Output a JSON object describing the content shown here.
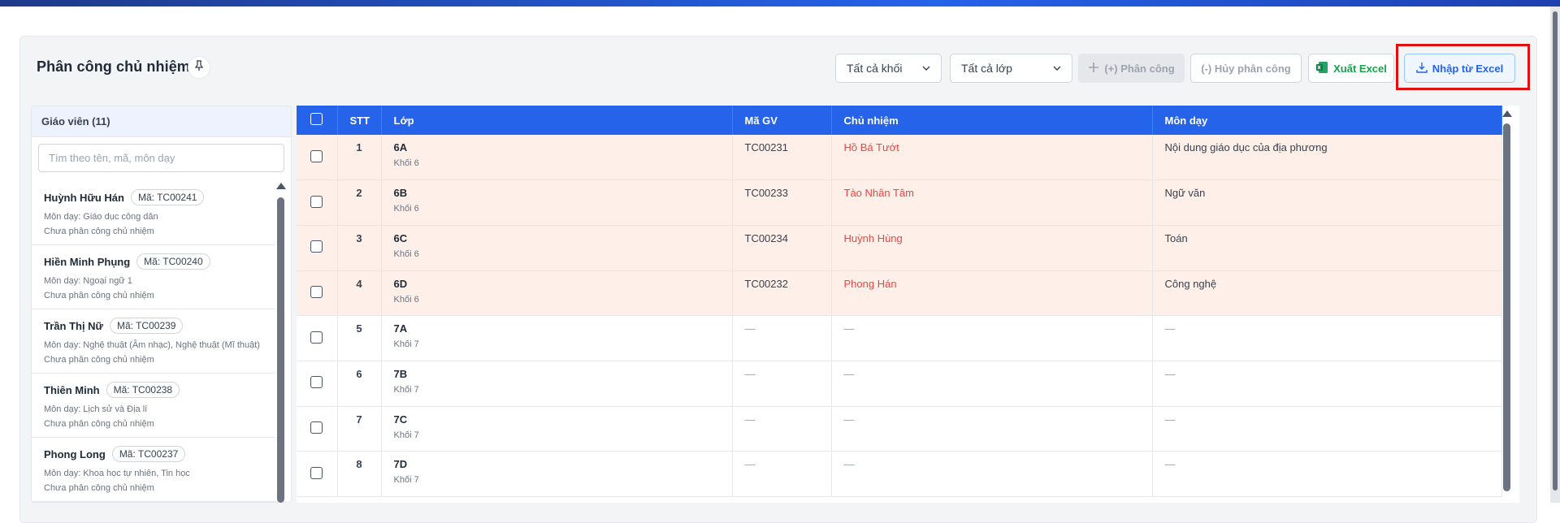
{
  "header": {
    "title": "Phân công chủ nhiệm",
    "grade_select": "Tất cả khối",
    "class_select": "Tất cả lớp",
    "assign_button": "(+) Phân công",
    "unassign_button": "(-) Hủy phân công",
    "export_button": "Xuất Excel",
    "import_button": "Nhập từ Excel"
  },
  "teachers_panel": {
    "title": "Giáo viên (11)",
    "search_placeholder": "Tìm theo tên, mã, môn dạy",
    "teachers": [
      {
        "name": "Huỳnh Hữu Hán",
        "code": "Mã: TC00241",
        "subject": "Môn dạy: Giáo dục công dân",
        "status": "Chưa phân công chủ nhiệm"
      },
      {
        "name": "Hiền Minh Phụng",
        "code": "Mã: TC00240",
        "subject": "Môn dạy: Ngoại ngữ 1",
        "status": "Chưa phân công chủ nhiệm"
      },
      {
        "name": "Trần Thị Nữ",
        "code": "Mã: TC00239",
        "subject": "Môn dạy: Nghệ thuật (Âm nhạc), Nghệ thuật (Mĩ thuật)",
        "status": "Chưa phân công chủ nhiệm"
      },
      {
        "name": "Thiên Minh",
        "code": "Mã: TC00238",
        "subject": "Môn dạy: Lịch sử và Địa lí",
        "status": "Chưa phân công chủ nhiệm"
      },
      {
        "name": "Phong Long",
        "code": "Mã: TC00237",
        "subject": "Môn dạy: Khoa học tự nhiên, Tin học",
        "status": "Chưa phân công chủ nhiệm"
      }
    ]
  },
  "table": {
    "columns": [
      "STT",
      "Lớp",
      "Mã GV",
      "Chủ nhiệm",
      "Môn dạy"
    ],
    "rows": [
      {
        "stt": "1",
        "class": "6A",
        "grade": "Khối 6",
        "teacher_code": "TC00231",
        "homeroom": "Hồ Bá Tướt",
        "subject": "Nội dung giáo dục của địa phương"
      },
      {
        "stt": "2",
        "class": "6B",
        "grade": "Khối 6",
        "teacher_code": "TC00233",
        "homeroom": "Tào Nhân Tâm",
        "subject": "Ngữ văn"
      },
      {
        "stt": "3",
        "class": "6C",
        "grade": "Khối 6",
        "teacher_code": "TC00234",
        "homeroom": "Huỳnh Hùng",
        "subject": "Toán"
      },
      {
        "stt": "4",
        "class": "6D",
        "grade": "Khối 6",
        "teacher_code": "TC00232",
        "homeroom": "Phong Hán",
        "subject": "Công nghệ"
      },
      {
        "stt": "5",
        "class": "7A",
        "grade": "Khối 7",
        "teacher_code": "—",
        "homeroom": "—",
        "subject": "—"
      },
      {
        "stt": "6",
        "class": "7B",
        "grade": "Khối 7",
        "teacher_code": "—",
        "homeroom": "—",
        "subject": "—"
      },
      {
        "stt": "7",
        "class": "7C",
        "grade": "Khối 7",
        "teacher_code": "—",
        "homeroom": "—",
        "subject": "—"
      },
      {
        "stt": "8",
        "class": "7D",
        "grade": "Khối 7",
        "teacher_code": "—",
        "homeroom": "—",
        "subject": "—"
      }
    ]
  },
  "colors": {
    "primary": "#2563eb",
    "assigned_row": "#fef0e8",
    "homeroom_text": "#ef4444",
    "excel_green": "#16a34a",
    "highlight": "#e01010"
  }
}
